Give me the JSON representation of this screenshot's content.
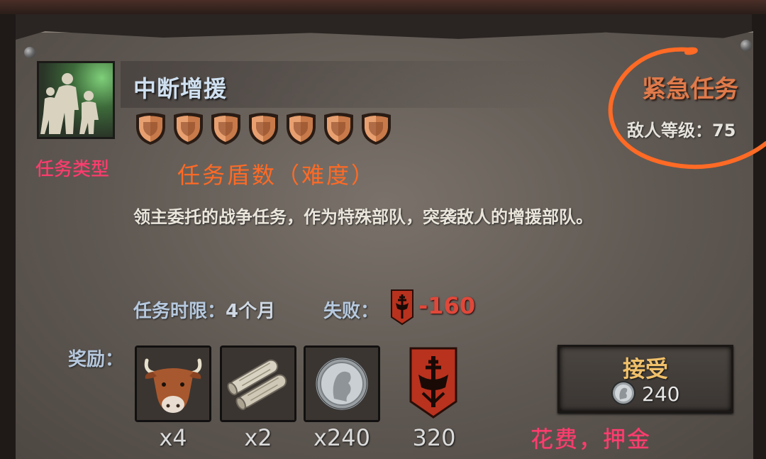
{
  "mission": {
    "title": "中断增援",
    "shield_count": 7,
    "urgent_label": "紧急任务",
    "enemy_level_label": "敌人等级：",
    "enemy_level_value": "75",
    "description": "领主委托的战争任务，作为特殊部队，突袭敌人的增援部队。",
    "time_limit_label": "任务时限：",
    "time_limit_value": "4个月",
    "failure_label": "失败：",
    "failure_value": "-160",
    "rewards_label": "奖励：",
    "rewards": [
      {
        "icon": "cattle-head-icon",
        "count": "x4"
      },
      {
        "icon": "scroll-icon",
        "count": "x2"
      },
      {
        "icon": "silver-coin-icon",
        "count": "x240"
      },
      {
        "icon": "faction-banner-icon",
        "count": "320"
      }
    ]
  },
  "accept_button": {
    "label": "接受",
    "cost_value": "240"
  },
  "annotations": {
    "mission_type": "任务类型",
    "mission_shields": "任务盾数（难度）",
    "cost_deposit": "花费，押金"
  },
  "colors": {
    "annotation_pink": "#ff3c6e",
    "annotation_orange": "#ff6a25",
    "title_blue": "#cfe0f0",
    "urgent_orange": "#e07a4a",
    "failure_red": "#e0483a",
    "accept_gold": "#f0c06a"
  }
}
